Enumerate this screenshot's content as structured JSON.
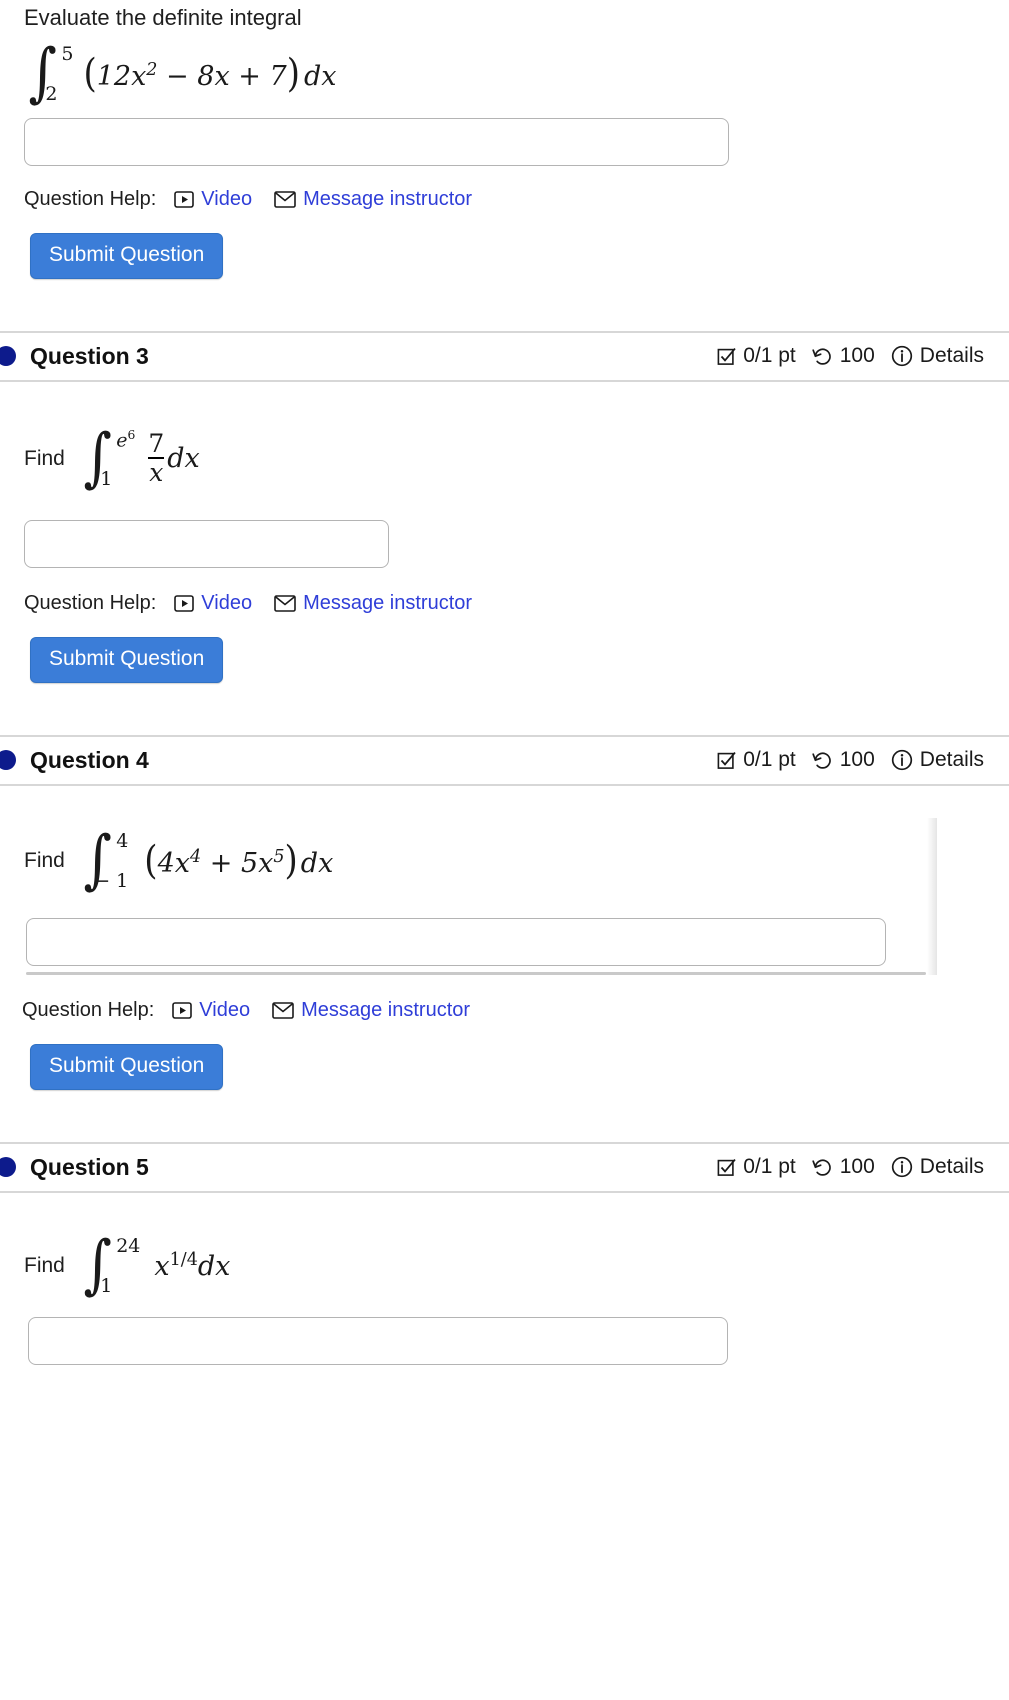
{
  "page": {
    "help_label": "Question Help:",
    "video_label": "Video",
    "message_label": "Message instructor",
    "submit_label": "Submit Question",
    "accent_link_color": "#2f3ed8",
    "submit_button_color": "#3b7dd8",
    "question_dot_color": "#0d1b8c",
    "divider_color": "#d7d7d7"
  },
  "question_top": {
    "prompt": "Evaluate the definite integral",
    "math": {
      "lower": "2",
      "upper": "5",
      "integrand": "(12x² − 8x + 7) dx",
      "integrand_parts": {
        "open": "(",
        "coef1": "12",
        "var1": "x",
        "pow1": "2",
        "op1": "−",
        "coef2": "8",
        "var2": "x",
        "op2": "+",
        "const": "7",
        "close": ")",
        "differential": "dx"
      }
    },
    "answer_value": "",
    "answer_placeholder": ""
  },
  "questions": [
    {
      "dot_icon": "status-dot-icon",
      "title": "Question 3",
      "score": "0/1 pt",
      "score_icon": "checkbox-icon",
      "attempts": "100",
      "attempts_icon": "retry-icon",
      "details_label": "Details",
      "details_icon": "info-icon",
      "find_label": "Find",
      "math": {
        "lower": "1",
        "upper": "e⁶",
        "upper_base": "e",
        "upper_exp": "6",
        "numerator": "7",
        "denominator": "x",
        "differential": "dx",
        "expression": "∫₁^(e⁶) 7/x dx"
      },
      "answer_value": "",
      "answer_placeholder": "",
      "answer_width": 364,
      "has_hscroll": false
    },
    {
      "dot_icon": "status-dot-icon",
      "title": "Question 4",
      "score": "0/1 pt",
      "score_icon": "checkbox-icon",
      "attempts": "100",
      "attempts_icon": "retry-icon",
      "details_label": "Details",
      "details_icon": "info-icon",
      "find_label": "Find",
      "math": {
        "lower": "− 1",
        "upper": "4",
        "open": "(",
        "coef1": "4",
        "var1": "x",
        "pow1": "4",
        "op1": "+",
        "coef2": "5",
        "var2": "x",
        "pow2": "5",
        "close": ")",
        "differential": "dx",
        "expression": "∫₋₁⁴ (4x⁴ + 5x⁵) dx"
      },
      "answer_value": "",
      "answer_placeholder": "",
      "answer_width": 845,
      "has_hscroll": true
    },
    {
      "dot_icon": "status-dot-icon",
      "title": "Question 5",
      "score": "0/1 pt",
      "score_icon": "checkbox-icon",
      "attempts": "100",
      "attempts_icon": "retry-icon",
      "details_label": "Details",
      "details_icon": "info-icon",
      "find_label": "Find",
      "math": {
        "lower": "1",
        "upper": "24",
        "var": "x",
        "exp_num": "1",
        "exp_slash": "/",
        "exp_den": "4",
        "differential": "dx",
        "expression": "∫₁²⁴ x^(1/4) dx"
      },
      "answer_value": "",
      "answer_placeholder": "",
      "answer_width": 700,
      "has_hscroll": false
    }
  ]
}
